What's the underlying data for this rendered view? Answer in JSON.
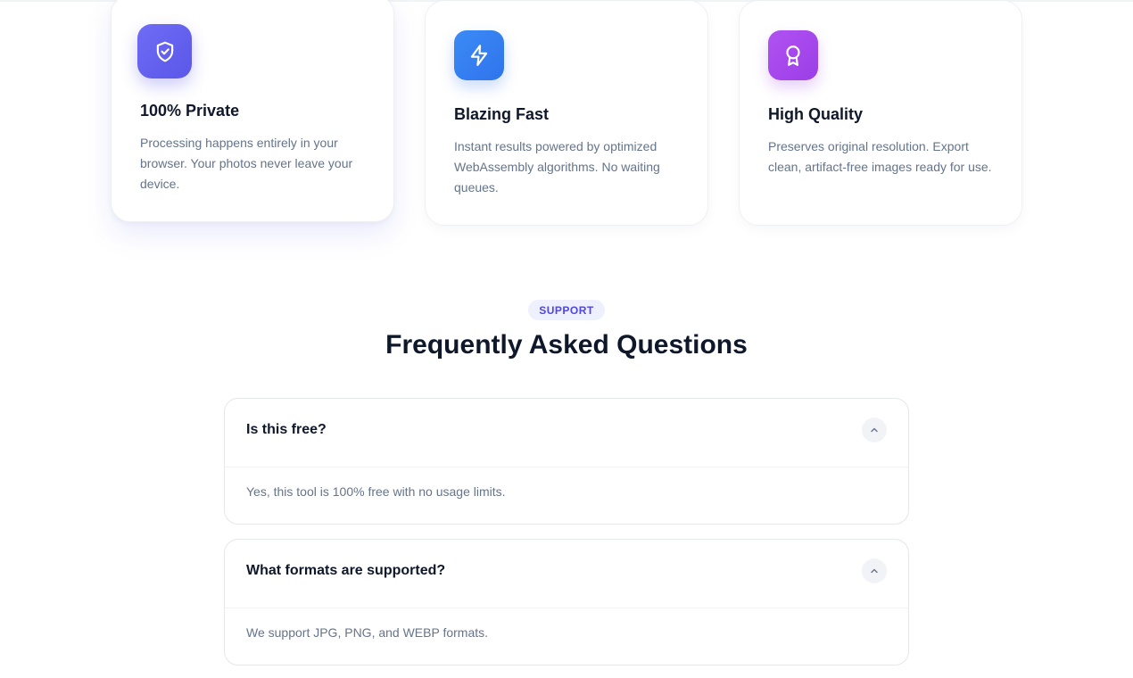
{
  "features": [
    {
      "title": "100% Private",
      "description": "Processing happens entirely in your browser. Your photos never leave your device.",
      "icon": "shield-check-icon",
      "color": "#5b57e8"
    },
    {
      "title": "Blazing Fast",
      "description": "Instant results powered by optimized WebAssembly algorithms. No waiting queues.",
      "icon": "lightning-icon",
      "color": "#2f74ec"
    },
    {
      "title": "High Quality",
      "description": "Preserves original resolution. Export clean, artifact-free images ready for use.",
      "icon": "award-icon",
      "color": "#9b3ee6"
    }
  ],
  "faq": {
    "badge": "SUPPORT",
    "title": "Frequently Asked Questions",
    "items": [
      {
        "question": "Is this free?",
        "answer": "Yes, this tool is 100% free with no usage limits.",
        "expanded": true
      },
      {
        "question": "What formats are supported?",
        "answer": "We support JPG, PNG, and WEBP formats.",
        "expanded": true
      }
    ]
  }
}
